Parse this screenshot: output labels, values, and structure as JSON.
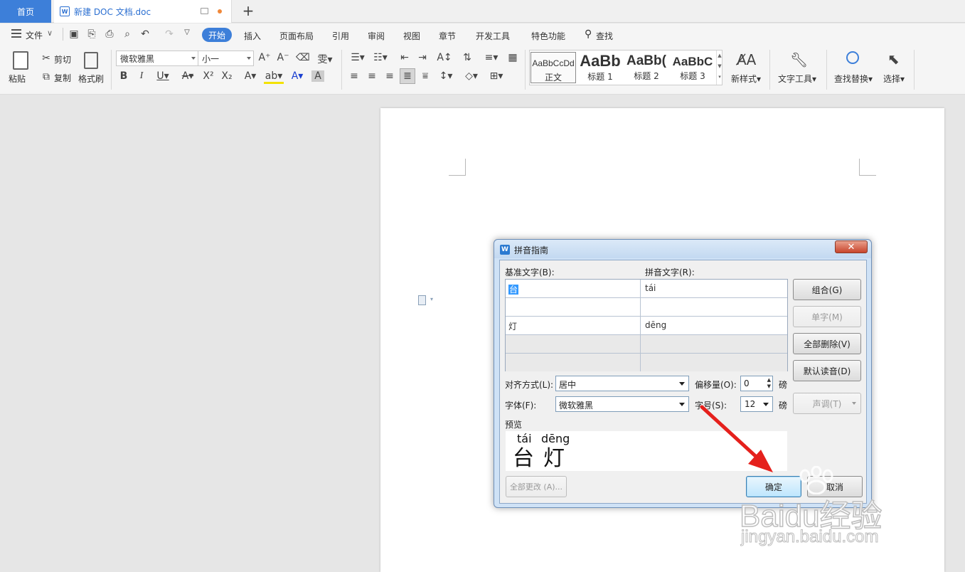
{
  "tabs": {
    "home": "首页",
    "doc_title": "新建 DOC 文档.doc",
    "add": "+"
  },
  "menu": {
    "file": "文件",
    "items": [
      "开始",
      "插入",
      "页面布局",
      "引用",
      "审阅",
      "视图",
      "章节",
      "开发工具",
      "特色功能",
      "查找"
    ]
  },
  "ribbon": {
    "paste": "粘贴",
    "cut": "剪切",
    "copy": "复制",
    "format_painter": "格式刷",
    "font_name": "微软雅黑",
    "font_size": "小一",
    "styles": [
      {
        "preview": "AaBbCcDd",
        "name": "正文"
      },
      {
        "preview": "AaBb",
        "name": "标题 1"
      },
      {
        "preview": "AaBb(",
        "name": "标题 2"
      },
      {
        "preview": "AaBbC",
        "name": "标题 3"
      }
    ],
    "new_style": "新样式",
    "text_tools": "文字工具",
    "find_replace": "查找替换",
    "select": "选择"
  },
  "dialog": {
    "title": "拼音指南",
    "base_label": "基准文字(B):",
    "ruby_label": "拼音文字(R):",
    "rows": [
      {
        "base": "台",
        "ruby": "tái"
      },
      {
        "base": "",
        "ruby": ""
      },
      {
        "base": "灯",
        "ruby": "dēng"
      },
      {
        "base": "",
        "ruby": ""
      },
      {
        "base": "",
        "ruby": ""
      }
    ],
    "buttons": {
      "group": "组合(G)",
      "mono": "单字(M)",
      "clear_all": "全部删除(V)",
      "default": "默认读音(D)",
      "tone": "声调(T)",
      "apply_all": "全部更改 (A)...",
      "ok": "确定",
      "cancel": "取消"
    },
    "align_label": "对齐方式(L):",
    "align_value": "居中",
    "offset_label": "偏移量(O):",
    "offset_value": "0",
    "offset_unit": "磅",
    "font_label": "字体(F):",
    "font_value": "微软雅黑",
    "size_label": "字号(S):",
    "size_value": "12",
    "size_unit": "磅",
    "preview_label": "预览",
    "preview_ruby": [
      "tái",
      "dēng"
    ],
    "preview_base": [
      "台",
      "灯"
    ]
  },
  "watermark": {
    "brand": "Baidu经验",
    "url": "jingyan.baidu.com"
  },
  "colors": {
    "accent": "#3d7fd9",
    "arrow": "#e5201c"
  }
}
